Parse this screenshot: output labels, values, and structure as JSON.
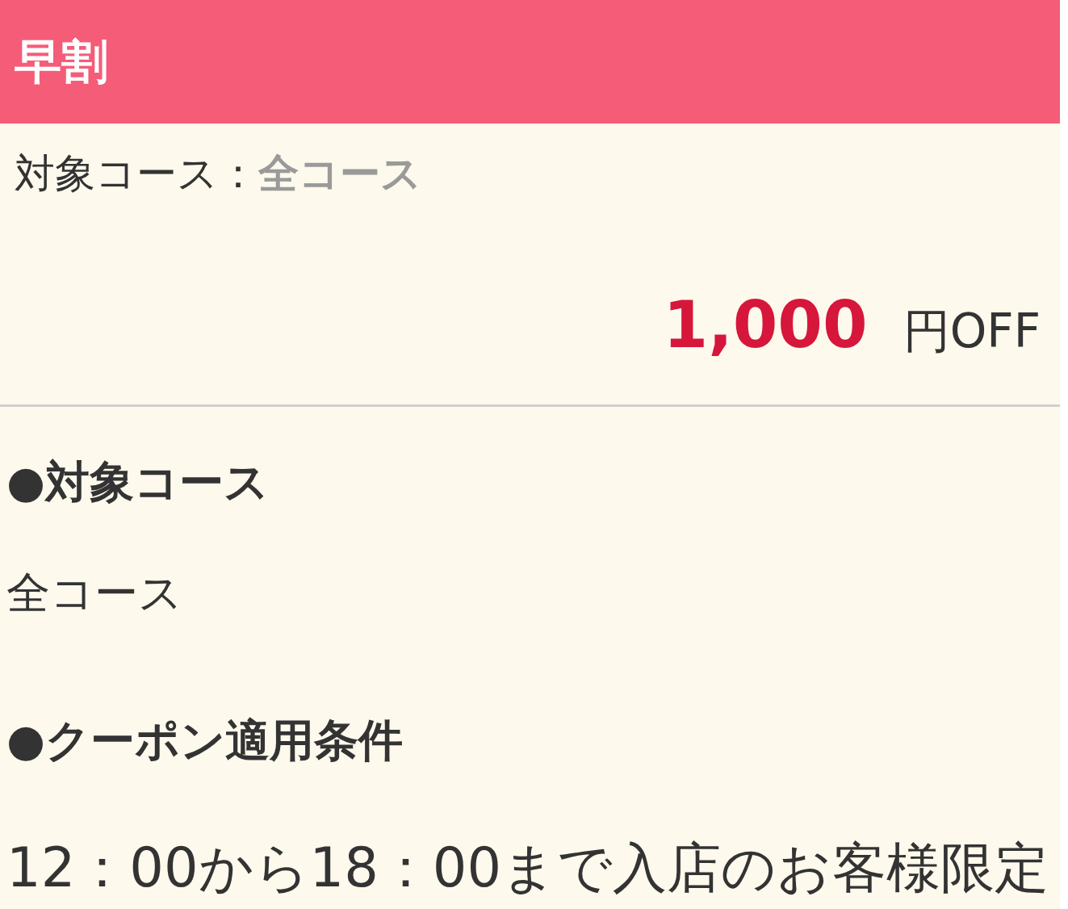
{
  "header": {
    "title": "早割"
  },
  "summary": {
    "label": "対象コース：",
    "value": "全コース"
  },
  "discount": {
    "amount": "1,000",
    "unit": "円OFF"
  },
  "details": [
    {
      "heading": "●対象コース",
      "body": "全コース"
    },
    {
      "heading": "●クーポン適用条件",
      "body": "12：00から18：00まで入店のお客様限定"
    }
  ]
}
